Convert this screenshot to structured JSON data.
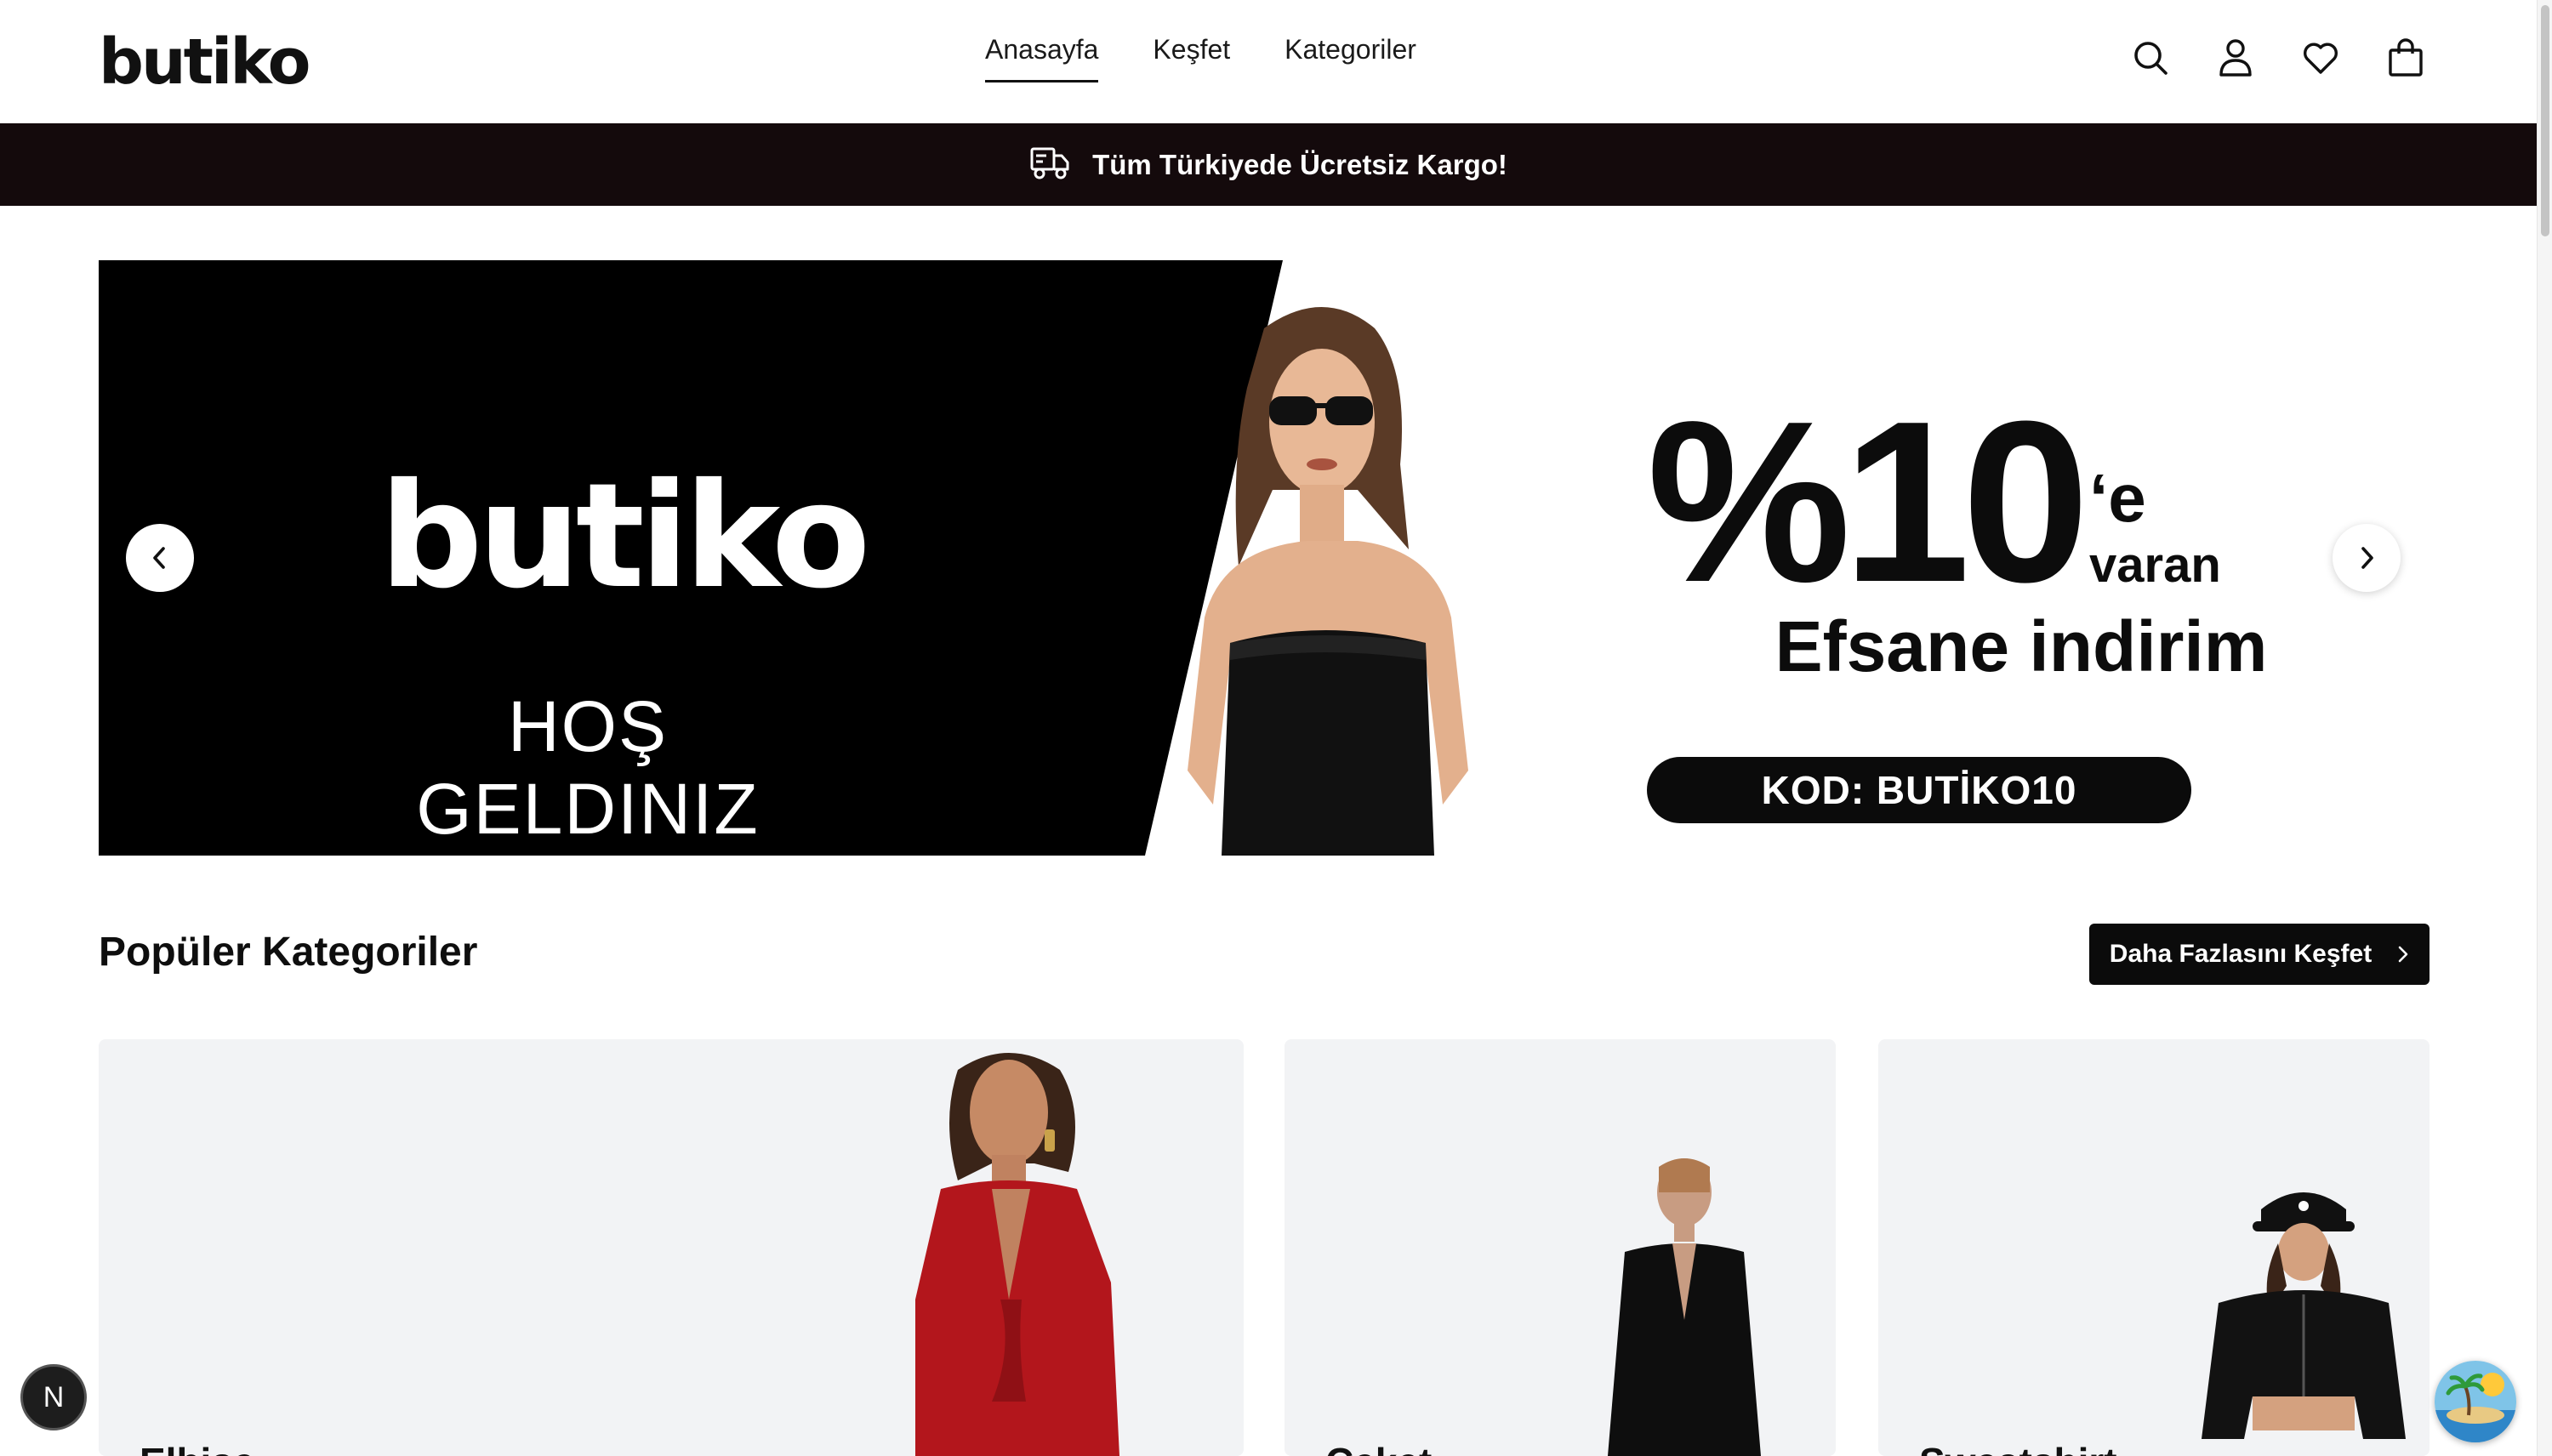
{
  "header": {
    "logo": "butiko",
    "nav": [
      {
        "label": "Anasayfa",
        "active": true
      },
      {
        "label": "Keşfet",
        "active": false
      },
      {
        "label": "Kategoriler",
        "active": false
      }
    ],
    "icons": [
      "search-icon",
      "user-icon",
      "heart-icon",
      "shopping-bag-icon"
    ]
  },
  "promo_bar": {
    "text": "Tüm Türkiyede Ücretsiz Kargo!",
    "icon": "delivery-truck-icon",
    "background": "#140a0c"
  },
  "hero": {
    "brand": "butiko",
    "welcome": "HOŞ GELDINIZ",
    "discount_number": "%10",
    "discount_suffix": "‘e",
    "discount_varan": "varan",
    "discount_label": "Efsane indirim",
    "code": "KOD: BUTİKO10"
  },
  "popular": {
    "title": "Popüler Kategoriler",
    "explore_label": "Daha Fazlasını Keşfet",
    "categories": [
      {
        "label": "Elbise"
      },
      {
        "label": "Ceket"
      },
      {
        "label": "Sweatshirt"
      }
    ]
  },
  "floating": {
    "dev_badge": "N"
  },
  "colors": {
    "accent": "#0b0b0b",
    "card_bg": "#f2f3f5",
    "dress_red": "#b3161c"
  }
}
